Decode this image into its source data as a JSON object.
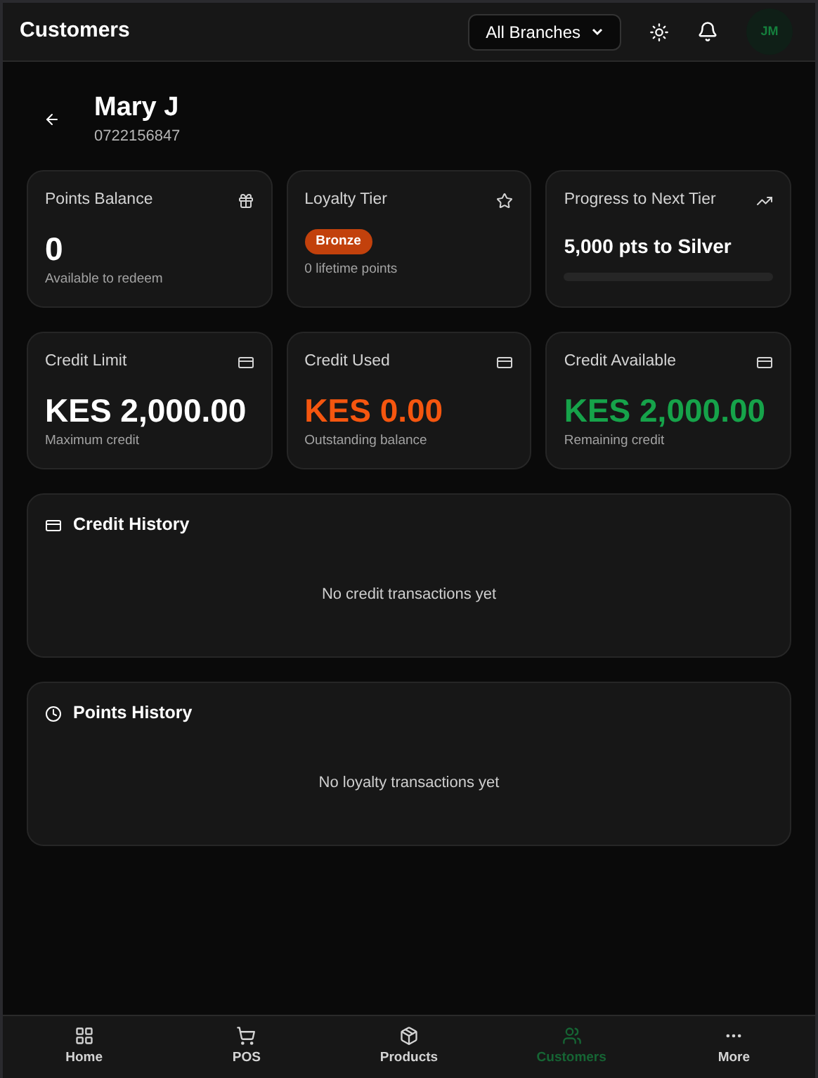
{
  "header": {
    "title": "Customers",
    "branch_select": {
      "value": "All Branches"
    },
    "avatar": "JM"
  },
  "customer": {
    "name": "Mary J",
    "phone": "0722156847"
  },
  "stats": [
    {
      "kind": "value",
      "label": "Points Balance",
      "value": "0",
      "note": "Available to redeem",
      "color": "#ffffff"
    },
    {
      "kind": "badge",
      "label": "Loyalty Tier",
      "badge": "Bronze",
      "note": "0 lifetime points"
    },
    {
      "kind": "progress",
      "label": "Progress to Next Tier",
      "value": "5,000 pts to Silver"
    },
    {
      "kind": "value",
      "label": "Credit Limit",
      "value": "KES 2,000.00",
      "note": "Maximum credit",
      "color": "#ffffff"
    },
    {
      "kind": "value",
      "label": "Credit Used",
      "value": "KES 0.00",
      "note": "Outstanding balance",
      "color": "#f5560f"
    },
    {
      "kind": "value",
      "label": "Credit Available",
      "value": "KES 2,000.00",
      "note": "Remaining credit",
      "color": "#16a34a"
    }
  ],
  "sections": [
    {
      "title": "Credit History",
      "empty": "No credit transactions yet"
    },
    {
      "title": "Points History",
      "empty": "No loyalty transactions yet"
    }
  ],
  "nav": [
    {
      "label": "Home",
      "selected": false
    },
    {
      "label": "POS",
      "selected": false
    },
    {
      "label": "Products",
      "selected": false
    },
    {
      "label": "Customers",
      "selected": true
    },
    {
      "label": "More",
      "selected": false
    }
  ]
}
